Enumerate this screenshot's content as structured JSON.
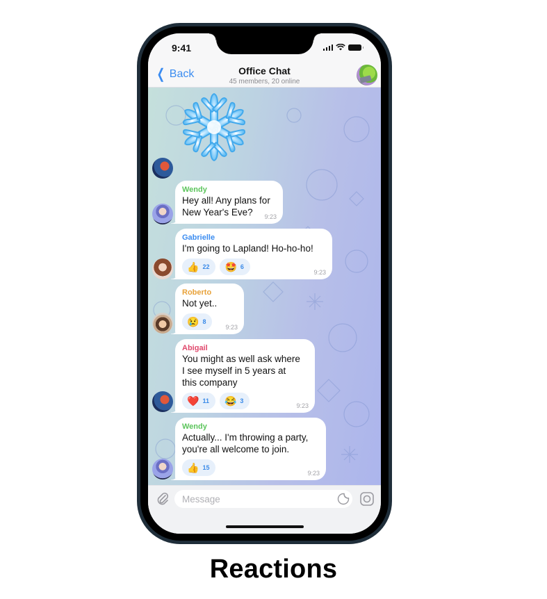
{
  "status_bar": {
    "time": "9:41"
  },
  "header": {
    "back_label": "Back",
    "title": "Office Chat",
    "subtitle": "45 members, 20 online"
  },
  "colors": {
    "accent": "#3b8cf0",
    "reaction_bg": "#e7f0fb",
    "reaction_count": "#3a8ae8",
    "wendy": "#5cc55c",
    "gabrielle": "#3b8cf0",
    "roberto": "#e8a23a",
    "abigail": "#e0486c"
  },
  "sticker": {
    "name": "snowflake-sticker"
  },
  "messages": [
    {
      "sender": "Wendy",
      "lines": [
        "Hey all! Any plans for",
        "New Year's Eve?"
      ],
      "time": "9:23",
      "reactions": []
    },
    {
      "sender": "Gabrielle",
      "lines": [
        "I'm going to Lapland! Ho-ho-ho!"
      ],
      "time": "9:23",
      "reactions": [
        {
          "emoji": "👍",
          "icon": "thumbs-up",
          "count": "22"
        },
        {
          "emoji": "🤩",
          "icon": "star-struck",
          "count": "6"
        }
      ]
    },
    {
      "sender": "Roberto",
      "lines": [
        "Not yet.."
      ],
      "time": "9:23",
      "reactions": [
        {
          "emoji": "😢",
          "icon": "crying-face",
          "count": "8"
        }
      ]
    },
    {
      "sender": "Abigail",
      "lines": [
        "You might as well ask where",
        "I see myself in 5 years at",
        "this company"
      ],
      "time": "9:23",
      "reactions": [
        {
          "emoji": "❤️",
          "icon": "red-heart",
          "count": "11"
        },
        {
          "emoji": "😂",
          "icon": "tears-of-joy",
          "count": "3"
        }
      ]
    },
    {
      "sender": "Wendy",
      "lines": [
        "Actually... I'm throwing a party,",
        "you're all welcome to join."
      ],
      "time": "9:23",
      "reactions": [
        {
          "emoji": "👍",
          "icon": "thumbs-up",
          "count": "15"
        }
      ]
    }
  ],
  "composer": {
    "placeholder": "Message",
    "value": ""
  },
  "caption": "Reactions"
}
